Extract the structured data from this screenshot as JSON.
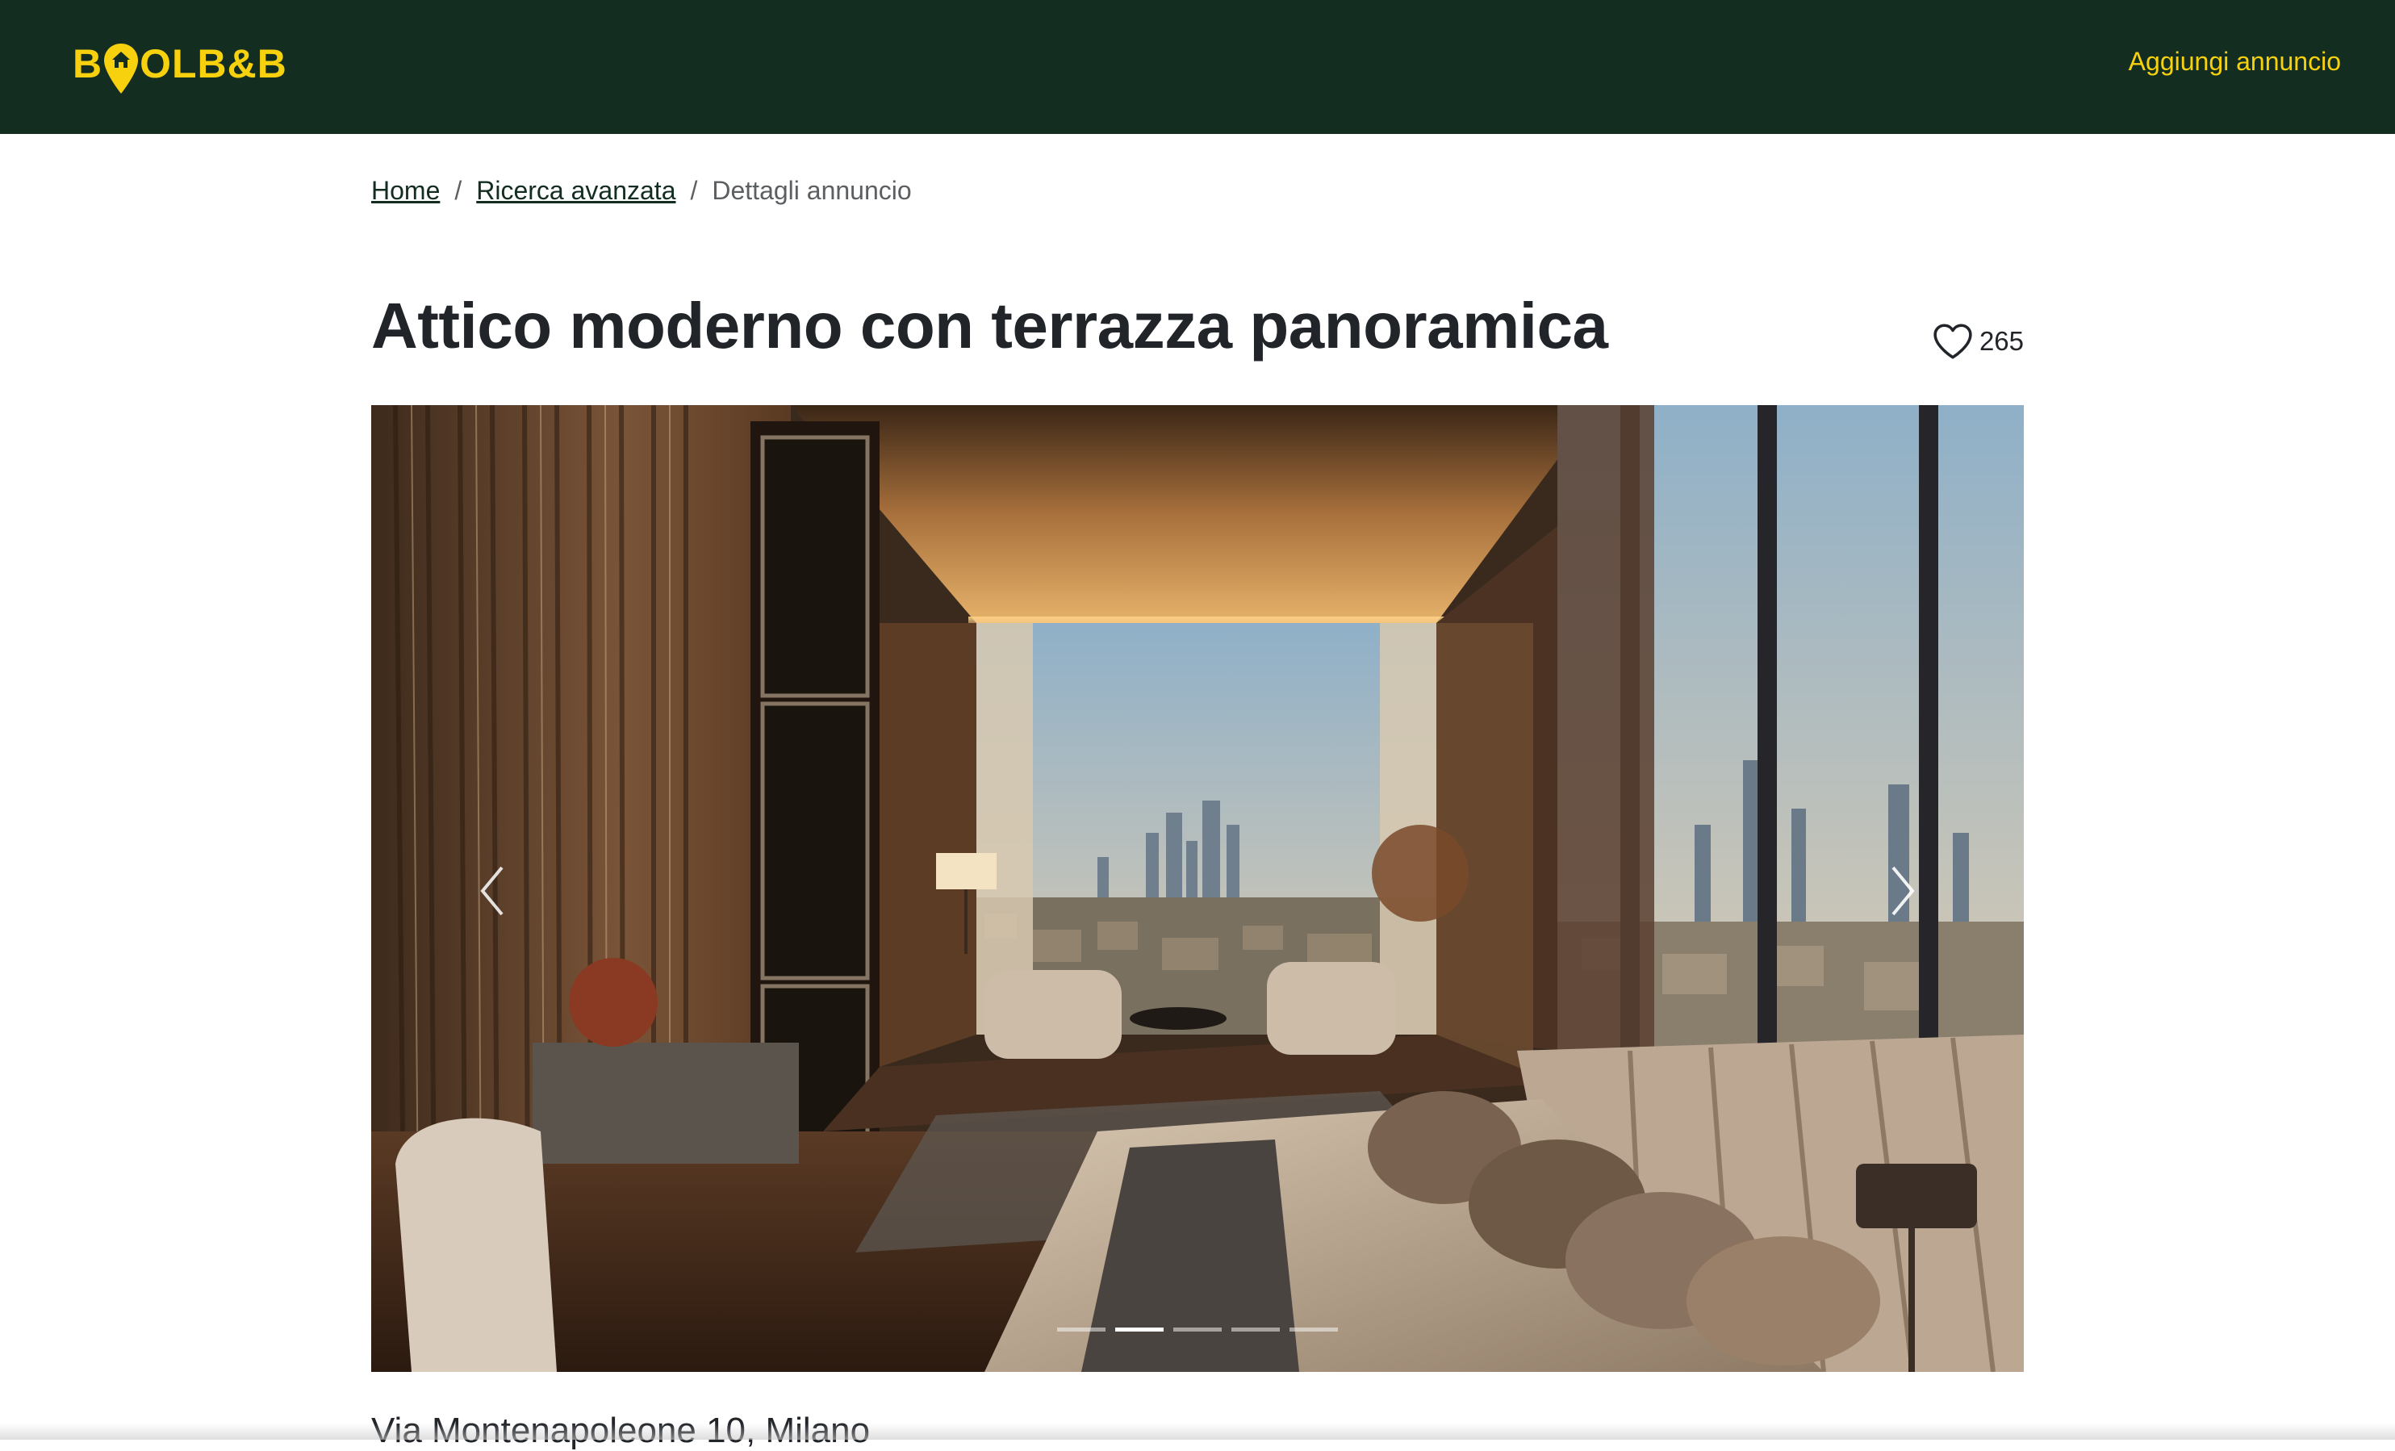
{
  "navbar": {
    "logo_text_left": "B",
    "logo_text_right": "OLB&B",
    "add_listing_label": "Aggiungi annuncio"
  },
  "breadcrumb": {
    "items": [
      "Home",
      "Ricerca avanzata"
    ],
    "current": "Dettagli annuncio",
    "separator": "/"
  },
  "listing": {
    "title": "Attico moderno con terrazza panoramica",
    "likes": "265",
    "address": "Via Montenapoleone 10, Milano"
  },
  "carousel": {
    "slide_count": 5,
    "active_index": 1
  },
  "colors": {
    "navbar_bg": "#132d21",
    "accent": "#f7d10d"
  },
  "icons": {
    "logo_pin": "location-pin-icon",
    "like": "heart-outline-icon",
    "prev": "chevron-left-icon",
    "next": "chevron-right-icon"
  }
}
